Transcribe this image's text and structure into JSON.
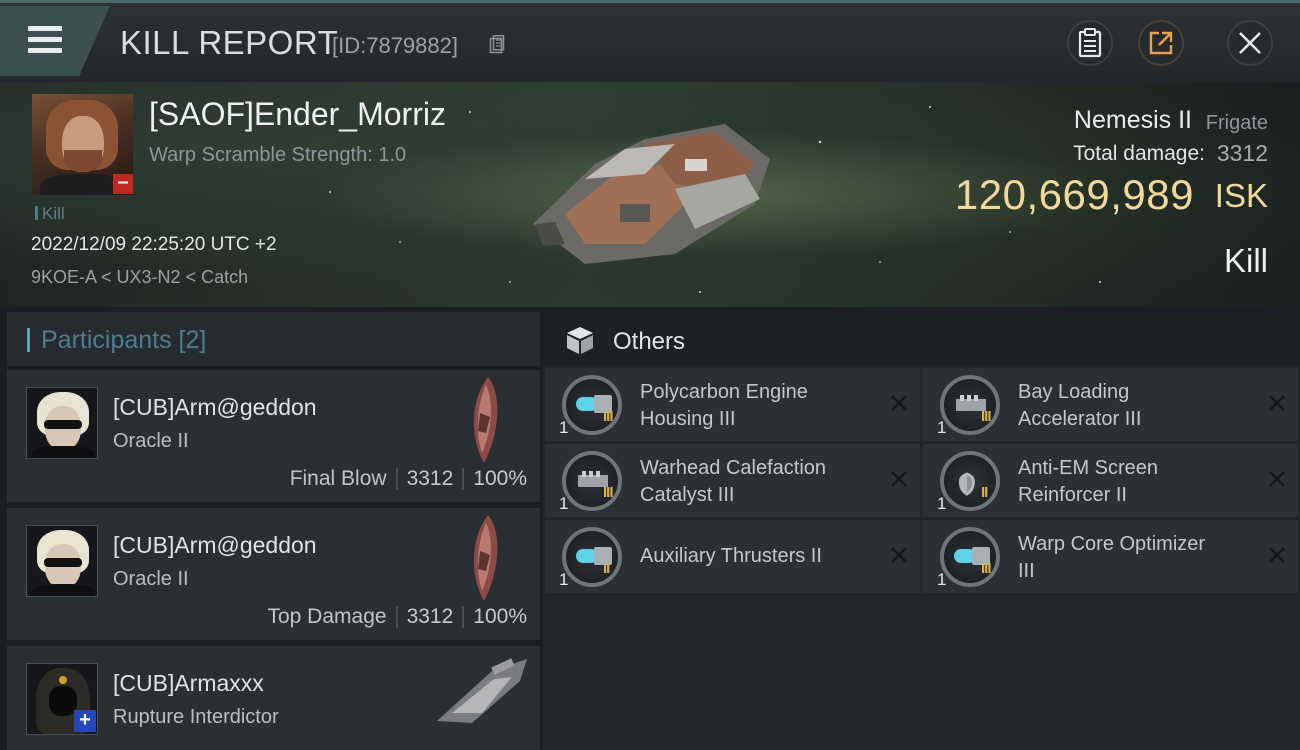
{
  "header": {
    "title": "KILL REPORT",
    "report_id": "[ID:7879882]"
  },
  "victim": {
    "name": "[SAOF]Ender_Morriz",
    "warp_scramble": "Warp Scramble Strength: 1.0",
    "tag": "Kill",
    "date": "2022/12/09 22:25:20 UTC +2",
    "location": "9KOE-A < UX3-N2 < Catch",
    "ship_name": "Nemesis II",
    "ship_class": "Frigate",
    "damage_label": "Total damage:",
    "damage_value": "3312",
    "isk_value": "120,669,989",
    "isk_unit": "ISK",
    "kill_type": "Kill"
  },
  "participants": {
    "title": "Participants [2]",
    "items": [
      {
        "name": "[CUB]Arm@geddon",
        "ship": "Oracle II",
        "role": "Final Blow",
        "damage": "3312",
        "percent": "100%"
      },
      {
        "name": "[CUB]Arm@geddon",
        "ship": "Oracle II",
        "role": "Top Damage",
        "damage": "3312",
        "percent": "100%"
      },
      {
        "name": "[CUB]Armaxxx",
        "ship": "Rupture Interdictor"
      }
    ]
  },
  "others": {
    "title": "Others",
    "items": [
      {
        "name": "Polycarbon Engine Housing III",
        "line1": "Polycarbon Engine",
        "line2": "Housing III",
        "qty": "1",
        "tier": "III",
        "icon": "engine-housing-icon"
      },
      {
        "name": "Bay Loading Accelerator III",
        "line1": "Bay Loading",
        "line2": "Accelerator III",
        "qty": "1",
        "tier": "III",
        "icon": "bay-loading-icon"
      },
      {
        "name": "Warhead Calefaction Catalyst III",
        "line1": "Warhead Calefaction",
        "line2": "Catalyst III",
        "qty": "1",
        "tier": "III",
        "icon": "warhead-catalyst-icon"
      },
      {
        "name": "Anti-EM Screen Reinforcer II",
        "line1": "Anti-EM Screen",
        "line2": "Reinforcer II",
        "qty": "1",
        "tier": "II",
        "icon": "shield-reinforcer-icon"
      },
      {
        "name": "Auxiliary Thrusters II",
        "line1": "Auxiliary Thrusters II",
        "line2": "",
        "qty": "1",
        "tier": "II",
        "icon": "thrusters-icon"
      },
      {
        "name": "Warp Core Optimizer III",
        "line1": "Warp Core Optimizer",
        "line2": "III",
        "qty": "1",
        "tier": "III",
        "icon": "warp-core-icon"
      }
    ]
  },
  "colors": {
    "isk_gold": "#f2d89b",
    "accent_teal": "#5ea6b5",
    "tier_gold": "#d9b34a",
    "loss_red": "#c0281f",
    "plus_blue": "#2447b8"
  }
}
